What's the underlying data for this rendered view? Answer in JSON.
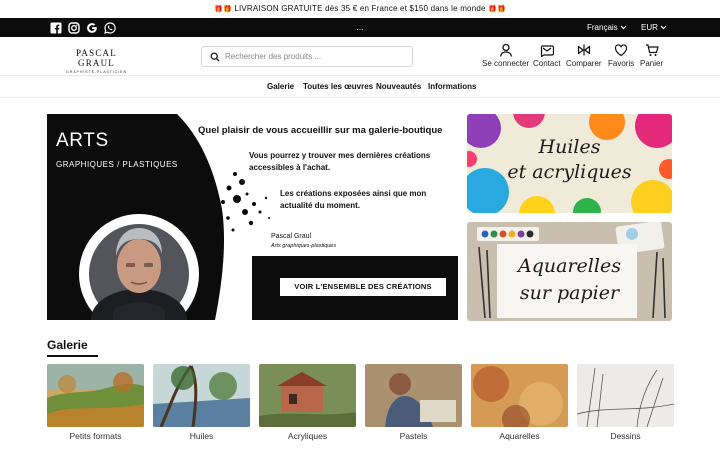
{
  "announcement": {
    "glyphs_left": "🎁🎁",
    "text": "LIVRAISON GRATUITE dès 35 € en France et $150 dans le monde",
    "glyphs_right": "🎁🎁"
  },
  "topbar": {
    "socials": [
      "facebook-icon",
      "instagram-icon",
      "google-icon",
      "whatsapp-icon"
    ],
    "middle": "...",
    "language": "Français",
    "currency": "EUR"
  },
  "header": {
    "logo_name": "PASCAL GRAUL",
    "logo_subtitle": "GRAPHISTE-PLASTICIEN",
    "search_placeholder": "Rechercher des produits ...",
    "icons": [
      {
        "name": "user-icon",
        "label": "Se connecter"
      },
      {
        "name": "mail-icon",
        "label": "Contact"
      },
      {
        "name": "compare-icon",
        "label": "Comparer"
      },
      {
        "name": "heart-icon",
        "label": "Favoris"
      },
      {
        "name": "cart-icon",
        "label": "Panier"
      }
    ]
  },
  "nav": [
    "Galerie",
    "Toutes les œuvres",
    "Nouveautés",
    "Informations"
  ],
  "hero": {
    "arts": "ARTS",
    "subtitle": "GRAPHIQUES / PLASTIQUES",
    "headline": "Quel plaisir de vous accueillir sur ma galerie-boutique",
    "para1": "Vous pourrez y trouver mes dernières créations accessibles à l'achat.",
    "para2": "Les créations exposées ainsi que mon actualité du moment.",
    "signature": "Pascal Graul",
    "signature_role": "Arts graphiques-plastiques",
    "cta": "VOIR L'ENSEMBLE DES CRÉATIONS"
  },
  "banners": [
    {
      "line1": "Huiles",
      "line2": "et acryliques"
    },
    {
      "line1": "Aquarelles",
      "line2": "sur papier"
    }
  ],
  "gallery": {
    "title": "Galerie",
    "items": [
      "Petits formats",
      "Huiles",
      "Acryliques",
      "Pastels",
      "Aquarelles",
      "Dessins"
    ]
  },
  "colors": {
    "black": "#0c0c0c",
    "white": "#ffffff",
    "text": "#222222"
  }
}
